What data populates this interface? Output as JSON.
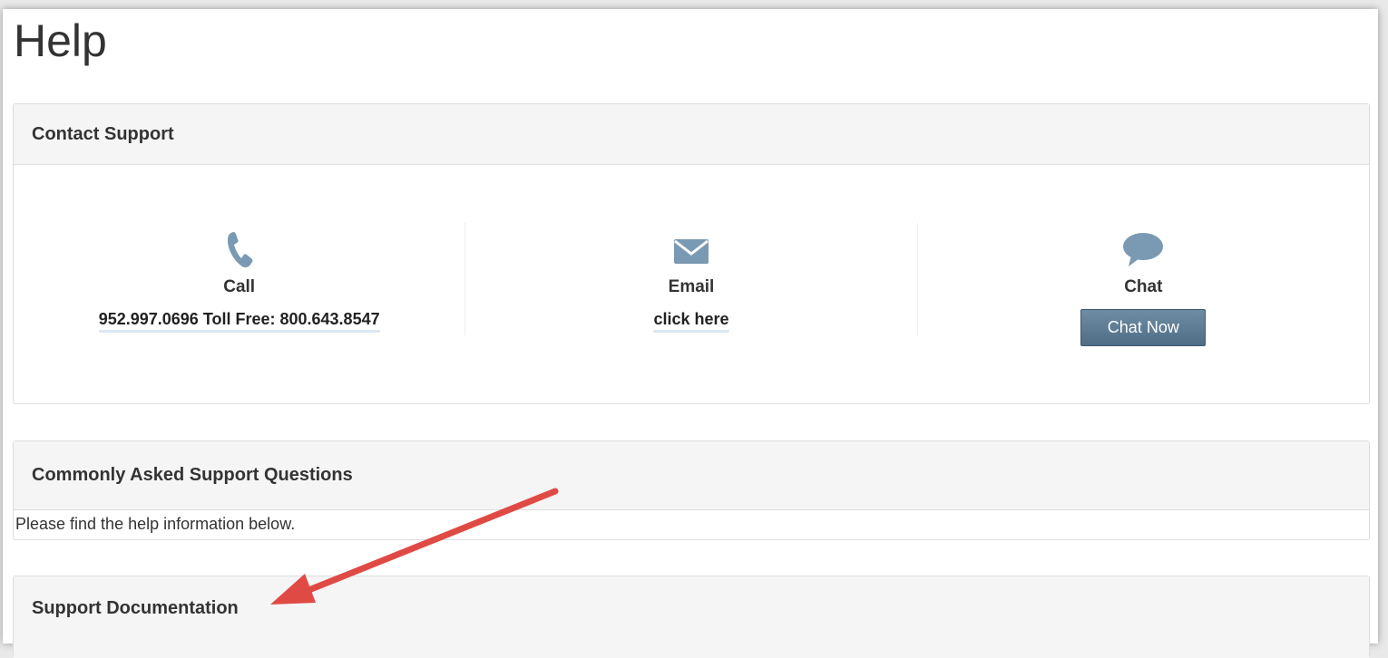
{
  "page": {
    "title": "Help"
  },
  "contact_support": {
    "heading": "Contact Support",
    "call": {
      "icon": "phone-icon",
      "label": "Call",
      "value": "952.997.0696 Toll Free: 800.643.8547"
    },
    "email": {
      "icon": "envelope-icon",
      "label": "Email",
      "link_text": "click here"
    },
    "chat": {
      "icon": "chat-bubble-icon",
      "label": "Chat",
      "button_label": "Chat Now"
    }
  },
  "faq": {
    "heading": "Commonly Asked Support Questions",
    "body": "Please find the help information below."
  },
  "docs": {
    "heading": "Support Documentation"
  },
  "colors": {
    "icon": "#7a9ab3",
    "button": "#587a93",
    "arrow": "#e04a45"
  }
}
